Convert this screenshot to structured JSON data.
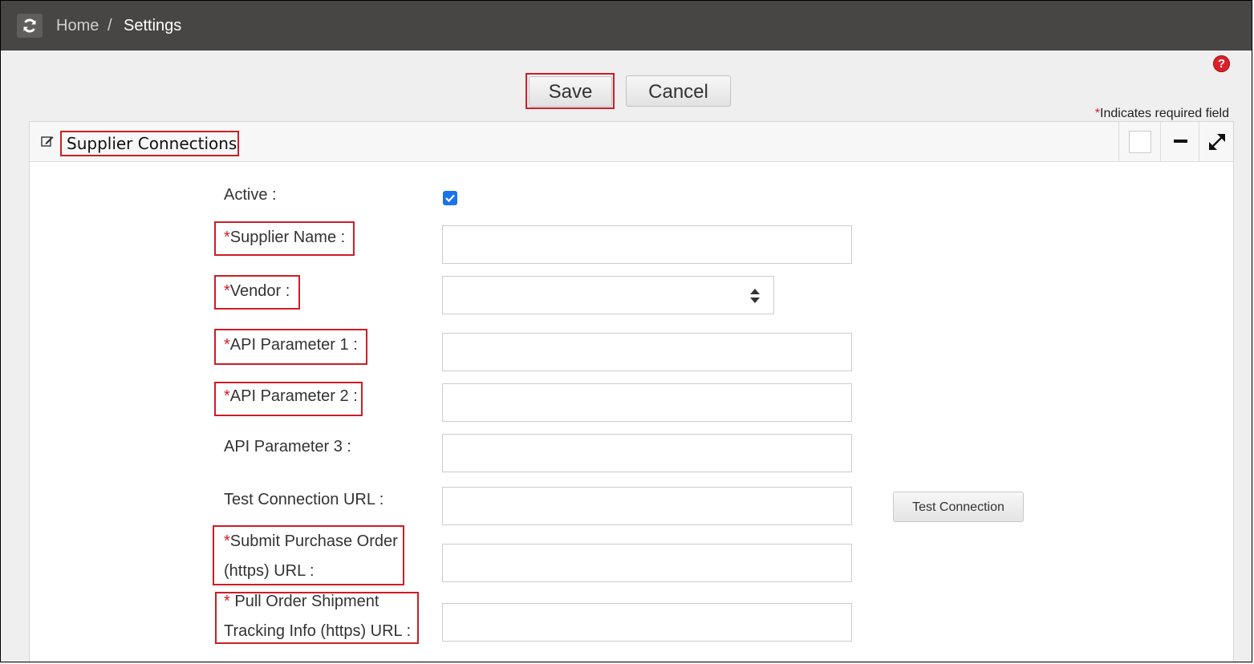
{
  "breadcrumb": {
    "home": "Home",
    "separator": "/",
    "current": "Settings"
  },
  "icons": {
    "app": "refresh-icon",
    "help": "question-icon",
    "edit": "edit-icon",
    "minimize": "minus-icon",
    "expand": "expand-icon",
    "select_arrows": "updown-arrows-icon",
    "check": "checkmark-icon"
  },
  "help": {
    "glyph": "?"
  },
  "toolbar": {
    "save_label": "Save",
    "cancel_label": "Cancel"
  },
  "required_note": {
    "star": "*",
    "text": "Indicates required field"
  },
  "panel": {
    "title": "Supplier Connections"
  },
  "form": {
    "active": {
      "label": "Active :",
      "checked": true
    },
    "supplier_name": {
      "star": "*",
      "label": "Supplier Name :",
      "value": ""
    },
    "vendor": {
      "star": "*",
      "label": "Vendor :",
      "value": ""
    },
    "api_param1": {
      "star": "*",
      "label": "API Parameter 1 :",
      "value": ""
    },
    "api_param2": {
      "star": "*",
      "label": "API Parameter 2 :",
      "value": ""
    },
    "api_param3": {
      "label": "API Parameter 3 :",
      "value": ""
    },
    "test_url": {
      "label": "Test Connection URL :",
      "value": "",
      "button": "Test Connection"
    },
    "submit_po": {
      "star": "*",
      "line1": "Submit Purchase Order",
      "line2": "(https) URL :",
      "value": ""
    },
    "pull_order": {
      "star": "*",
      "line1": " Pull Order Shipment",
      "line2": "Tracking Info (https) URL :",
      "value": ""
    }
  },
  "colors": {
    "topbar": "#474645",
    "highlight": "#d01c26",
    "required": "#d01c26",
    "checkbox": "#1a73e8"
  }
}
